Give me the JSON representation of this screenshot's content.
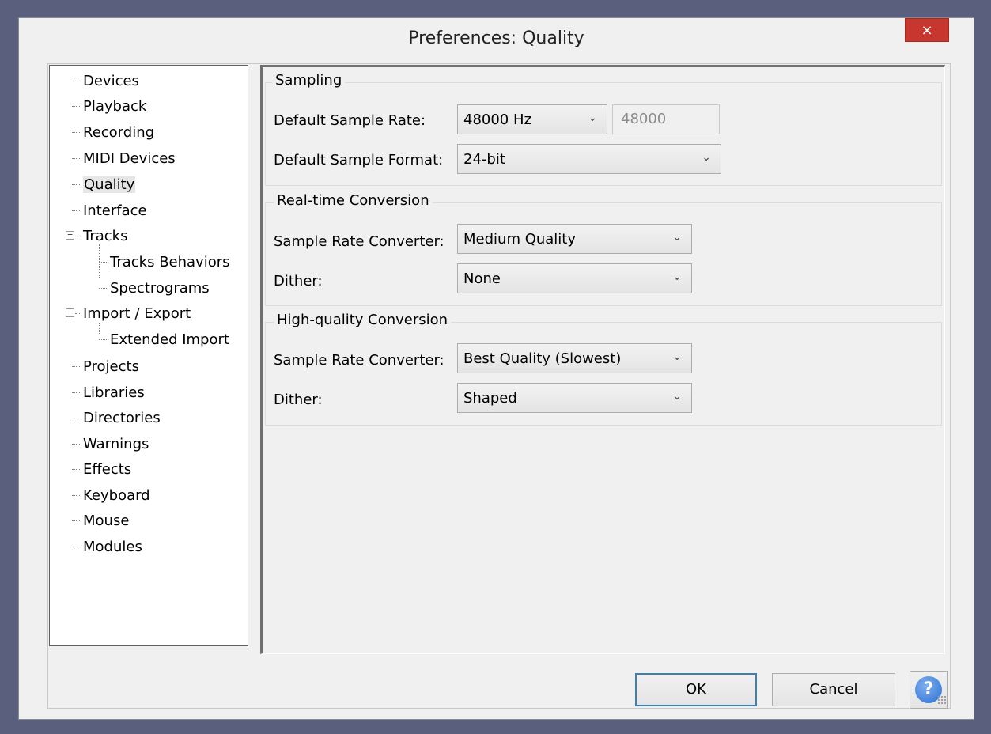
{
  "window": {
    "title": "Preferences: Quality",
    "close_label": "×"
  },
  "tree": {
    "items": [
      {
        "label": "Devices"
      },
      {
        "label": "Playback"
      },
      {
        "label": "Recording"
      },
      {
        "label": "MIDI Devices"
      },
      {
        "label": "Quality",
        "selected": true
      },
      {
        "label": "Interface"
      },
      {
        "label": "Tracks",
        "expanded": true
      },
      {
        "label": "Tracks Behaviors"
      },
      {
        "label": "Spectrograms"
      },
      {
        "label": "Import / Export",
        "expanded": true
      },
      {
        "label": "Extended Import"
      },
      {
        "label": "Projects"
      },
      {
        "label": "Libraries"
      },
      {
        "label": "Directories"
      },
      {
        "label": "Warnings"
      },
      {
        "label": "Effects"
      },
      {
        "label": "Keyboard"
      },
      {
        "label": "Mouse"
      },
      {
        "label": "Modules"
      }
    ],
    "collapse_glyph": "−"
  },
  "sampling": {
    "title": "Sampling",
    "rate_label": "Default Sample Rate:",
    "rate_value": "48000 Hz",
    "rate_text": "48000",
    "format_label": "Default Sample Format:",
    "format_value": "24-bit"
  },
  "realtime": {
    "title": "Real-time Conversion",
    "converter_label": "Sample Rate Converter:",
    "converter_value": "Medium Quality",
    "dither_label": "Dither:",
    "dither_value": "None"
  },
  "highquality": {
    "title": "High-quality Conversion",
    "converter_label": "Sample Rate Converter:",
    "converter_value": "Best Quality (Slowest)",
    "dither_label": "Dither:",
    "dither_value": "Shaped"
  },
  "buttons": {
    "ok": "OK",
    "cancel": "Cancel",
    "help": "?"
  },
  "icons": {
    "chevron": "chevron-down-icon",
    "help": "help-icon",
    "close": "close-icon"
  },
  "colors": {
    "close_bg": "#c7372f",
    "ok_border": "#3c7fb1",
    "help_blue": "#2a6fd2"
  }
}
